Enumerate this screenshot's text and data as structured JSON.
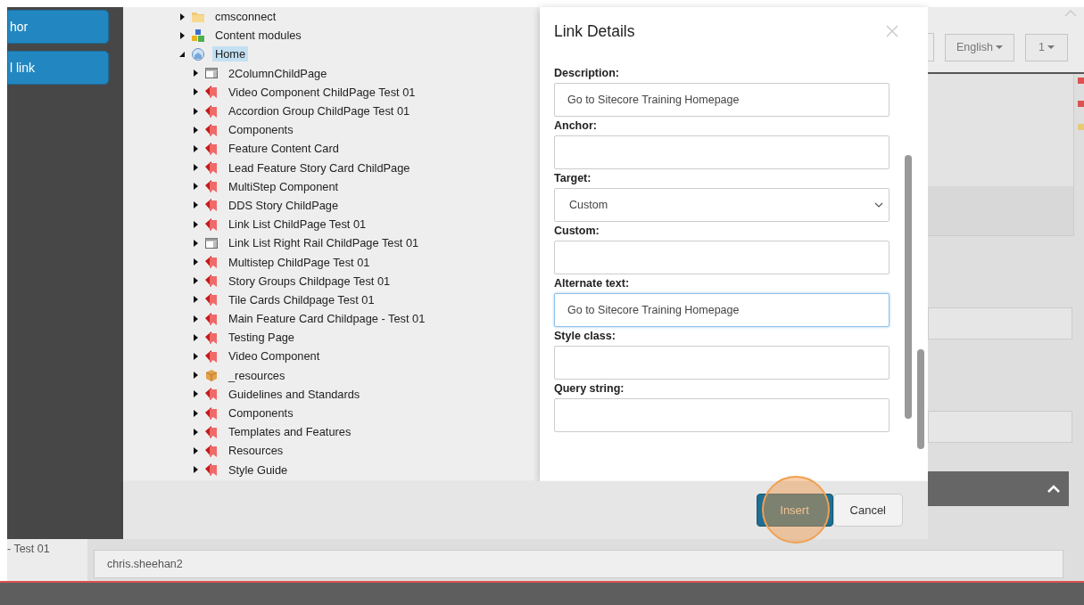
{
  "sidebar": {
    "buttons": [
      "hor",
      "l link"
    ]
  },
  "tree": {
    "items": [
      {
        "label": "cmsconnect",
        "kind": "folder",
        "expanded": false,
        "selected": false
      },
      {
        "label": "Content modules",
        "kind": "modules",
        "expanded": false,
        "selected": false
      },
      {
        "label": "Home",
        "kind": "home",
        "expanded": true,
        "selected": true,
        "children": [
          {
            "label": "2ColumnChildPage",
            "kind": "layout",
            "expanded": false,
            "selected": false
          },
          {
            "label": "Video Component ChildPage Test 01",
            "kind": "page",
            "expanded": false,
            "selected": false
          },
          {
            "label": "Accordion Group ChildPage Test 01",
            "kind": "page",
            "expanded": false,
            "selected": false
          },
          {
            "label": "Components",
            "kind": "page",
            "expanded": false,
            "selected": false
          },
          {
            "label": "Feature Content Card",
            "kind": "page",
            "expanded": false,
            "selected": false
          },
          {
            "label": "Lead Feature Story Card ChildPage",
            "kind": "page",
            "expanded": false,
            "selected": false
          },
          {
            "label": "MultiStep Component",
            "kind": "page",
            "expanded": false,
            "selected": false
          },
          {
            "label": "DDS Story ChildPage",
            "kind": "page",
            "expanded": false,
            "selected": false
          },
          {
            "label": "Link List ChildPage Test 01",
            "kind": "page",
            "expanded": false,
            "selected": false
          },
          {
            "label": "Link List Right Rail ChildPage Test 01",
            "kind": "layout",
            "expanded": false,
            "selected": false
          },
          {
            "label": "Multistep ChildPage Test 01",
            "kind": "page",
            "expanded": false,
            "selected": false
          },
          {
            "label": "Story Groups Childpage Test 01",
            "kind": "page",
            "expanded": false,
            "selected": false
          },
          {
            "label": "Tile Cards Childpage Test 01",
            "kind": "page",
            "expanded": false,
            "selected": false
          },
          {
            "label": "Main Feature Card Childpage - Test 01",
            "kind": "page",
            "expanded": false,
            "selected": false
          },
          {
            "label": "Testing Page",
            "kind": "page",
            "expanded": false,
            "selected": false
          },
          {
            "label": "Video Component",
            "kind": "page",
            "expanded": false,
            "selected": false
          },
          {
            "label": "_resources",
            "kind": "box",
            "expanded": false,
            "selected": false
          },
          {
            "label": "Guidelines and Standards",
            "kind": "page",
            "expanded": false,
            "selected": false
          },
          {
            "label": "Components",
            "kind": "page",
            "expanded": false,
            "selected": false
          },
          {
            "label": "Templates and Features",
            "kind": "page",
            "expanded": false,
            "selected": false
          },
          {
            "label": "Resources",
            "kind": "page",
            "expanded": false,
            "selected": false
          },
          {
            "label": "Style Guide",
            "kind": "page",
            "expanded": false,
            "selected": false
          }
        ]
      }
    ]
  },
  "dialog": {
    "title": "Link Details",
    "fields": [
      {
        "label": "Description:",
        "kind": "text",
        "value": "Go to Sitecore Training Homepage",
        "focused": false
      },
      {
        "label": "Anchor:",
        "kind": "text",
        "focused": false
      },
      {
        "label": "Target:",
        "kind": "select",
        "value": "Custom",
        "focused": false
      },
      {
        "label": "Custom:",
        "kind": "text",
        "focused": false
      },
      {
        "label": "Alternate text:",
        "kind": "text",
        "value": "Go to Sitecore Training Homepage",
        "focused": true
      },
      {
        "label": "Style class:",
        "kind": "text",
        "focused": false
      },
      {
        "label": "Query string:",
        "kind": "text",
        "focused": false
      }
    ],
    "buttons": [
      {
        "label": "Insert",
        "primary": true
      },
      {
        "label": "Cancel",
        "primary": false
      }
    ]
  },
  "background": {
    "language": "English",
    "version": "1",
    "markers": [
      {
        "color": "#d9534f"
      },
      {
        "color": "#d9534f"
      },
      {
        "color": "#e8c97a"
      }
    ],
    "left_label": "- Test 01",
    "author_value": "chris.sheehan2"
  }
}
